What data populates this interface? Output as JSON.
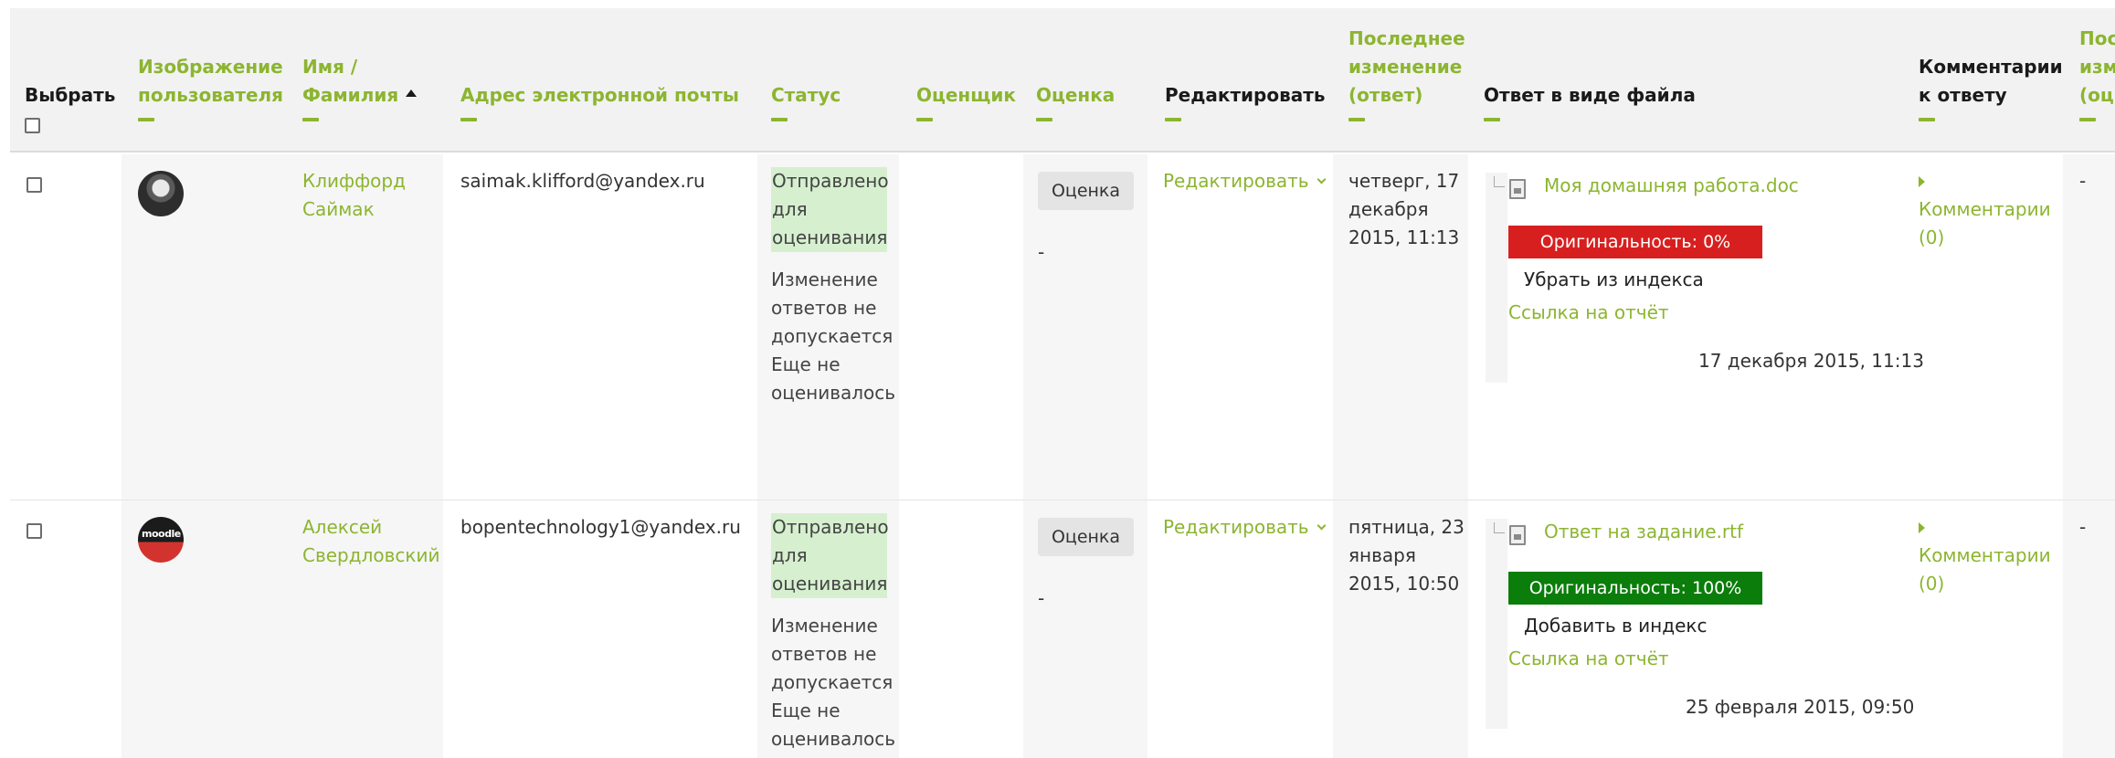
{
  "headers": {
    "select": "Выбрать",
    "user_image": "Изображение пользователя",
    "name_1": "Имя /",
    "name_2": "Фамилия",
    "email": "Адрес электронной почты",
    "status": "Статус",
    "grader": "Оценщик",
    "grade": "Оценка",
    "edit": "Редактировать",
    "modified_1": "Последнее",
    "modified_2": "изменение",
    "modified_3": "(ответ)",
    "file_submission": "Ответ в виде файла",
    "comments_1": "Комментарии",
    "comments_2": "к ответу",
    "last_col_1": "Пос",
    "last_col_2": "изм",
    "last_col_3": "(оц"
  },
  "rows": [
    {
      "first_name": "Клиффорд",
      "last_name": "Саймак",
      "email": "saimak.klifford@yandex.ru",
      "status_1": "Отправлено",
      "status_2": "для",
      "status_3": "оценивания",
      "lock_1": "Изменение",
      "lock_2": "ответов не",
      "lock_3": "допускается",
      "grading_1": "Еще не",
      "grading_2": "оценивалось",
      "grade_button": "Оценка",
      "grade_value": "-",
      "edit_label": "Редактировать",
      "modified_1": "четверг, 17",
      "modified_2": "декабря",
      "modified_3": "2015, 11:13",
      "file_name": "Моя домашняя работа.doc",
      "originality": "Оригинальность: 0%",
      "index_action": "Убрать из индекса",
      "report_link": "Ссылка на отчёт",
      "file_date": "17 декабря 2015, 11:13",
      "comments": "Комментарии",
      "comments_count": "(0)",
      "last_col": "-"
    },
    {
      "first_name": "Алексей",
      "last_name": "Свердловский",
      "email": "bopentechnology1@yandex.ru",
      "status_1": "Отправлено",
      "status_2": "для",
      "status_3": "оценивания",
      "lock_1": "Изменение",
      "lock_2": "ответов не",
      "lock_3": "допускается",
      "grading_1": "Еще не",
      "grading_2": "оценивалось",
      "grade_button": "Оценка",
      "grade_value": "-",
      "edit_label": "Редактировать",
      "modified_1": "пятница, 23",
      "modified_2": "января",
      "modified_3": "2015, 10:50",
      "file_name": "Ответ на задание.rtf",
      "originality": "Оригинальность: 100%",
      "index_action": "Добавить в индекс",
      "report_link": "Ссылка на отчёт",
      "file_date": "25 февраля 2015, 09:50",
      "comments": "Комментарии",
      "comments_count": "(0)",
      "last_col": "-"
    }
  ],
  "avatar2_text": "moodle",
  "colors": {
    "accent": "#8cb530",
    "header_bg": "#f2f2f2",
    "status_bg": "#d6f0cf",
    "originality_low": "#d81f1f",
    "originality_high": "#0a7d0a"
  }
}
